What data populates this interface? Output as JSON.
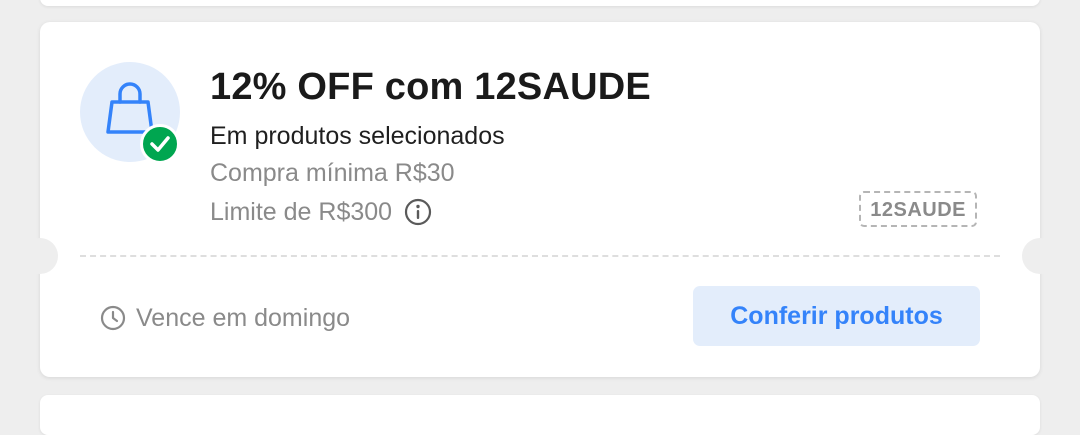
{
  "coupon": {
    "title": "12% OFF com 12SAUDE",
    "subtitle": "Em produtos selecionados",
    "min_purchase": "Compra mínima R$30",
    "limit": "Limite de R$300",
    "code": "12SAUDE",
    "expiration": "Vence em domingo",
    "cta_label": "Conferir produtos",
    "icon": "shopping-bag-icon",
    "badge_icon": "check-icon"
  },
  "colors": {
    "accent": "#3483fa",
    "accent_bg": "#e3edfb",
    "success": "#00a650",
    "text_primary": "#1a1a1a",
    "text_secondary": "#8a8a8a",
    "page_bg": "#eeeeee"
  }
}
